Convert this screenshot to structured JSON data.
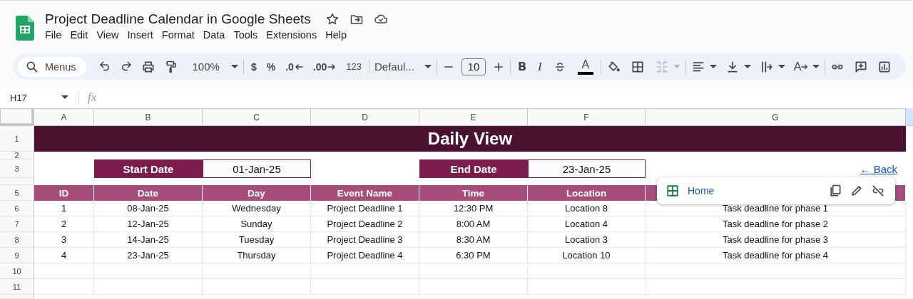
{
  "document": {
    "title": "Project Deadline Calendar in Google Sheets"
  },
  "menu": [
    "File",
    "Edit",
    "View",
    "Insert",
    "Format",
    "Data",
    "Tools",
    "Extensions",
    "Help"
  ],
  "toolbar": {
    "search_label": "Menus",
    "zoom": "100%",
    "number_formats": [
      {
        "kind": "currency",
        "label": "$"
      },
      {
        "kind": "percent",
        "label": "%"
      },
      {
        "kind": "decrease_decimal",
        "label": ".0"
      },
      {
        "kind": "increase_decimal",
        "label": ".00"
      },
      {
        "kind": "more",
        "label": "123"
      }
    ],
    "font": "Defaul...",
    "font_size": "10",
    "bold": "B",
    "italic": "I",
    "text_color": "A",
    "rotation": "A",
    "merge_disabled": true
  },
  "formula_bar": {
    "cell": "H17",
    "label": "fx"
  },
  "sheet": {
    "columns": [
      "A",
      "B",
      "C",
      "D",
      "E",
      "F",
      "G"
    ],
    "title": {
      "row": "1",
      "text": "Daily View"
    },
    "row_2": "2",
    "dates": {
      "row": "3",
      "start_label": "Start Date",
      "start": "01-Jan-25",
      "end_label": "End Date",
      "end": "23-Jan-25",
      "back_link": "← Back"
    },
    "header": {
      "row": "5",
      "cells": [
        "ID",
        "Date",
        "Day",
        "Event Name",
        "Time",
        "Location"
      ]
    },
    "rows": [
      {
        "row": "6",
        "cells": [
          "1",
          "08-Jan-25",
          "Wednesday",
          "Project Deadline 1",
          "12:30 PM",
          "Location 8",
          "Task deadline for phase 1"
        ]
      },
      {
        "row": "7",
        "cells": [
          "2",
          "12-Jan-25",
          "Sunday",
          "Project Deadline 2",
          "8:00 AM",
          "Location 4",
          "Task deadline for phase 2"
        ]
      },
      {
        "row": "8",
        "cells": [
          "3",
          "14-Jan-25",
          "Tuesday",
          "Project Deadline 3",
          "8:30 AM",
          "Location 3",
          "Task deadline for phase 3"
        ]
      },
      {
        "row": "9",
        "cells": [
          "4",
          "23-Jan-25",
          "Thursday",
          "Project Deadline 4",
          "6:30 PM",
          "Location 10",
          "Task deadline for phase 4"
        ]
      }
    ],
    "empty_rows": [
      "10",
      "11"
    ]
  },
  "popup": {
    "link": "Home"
  }
}
